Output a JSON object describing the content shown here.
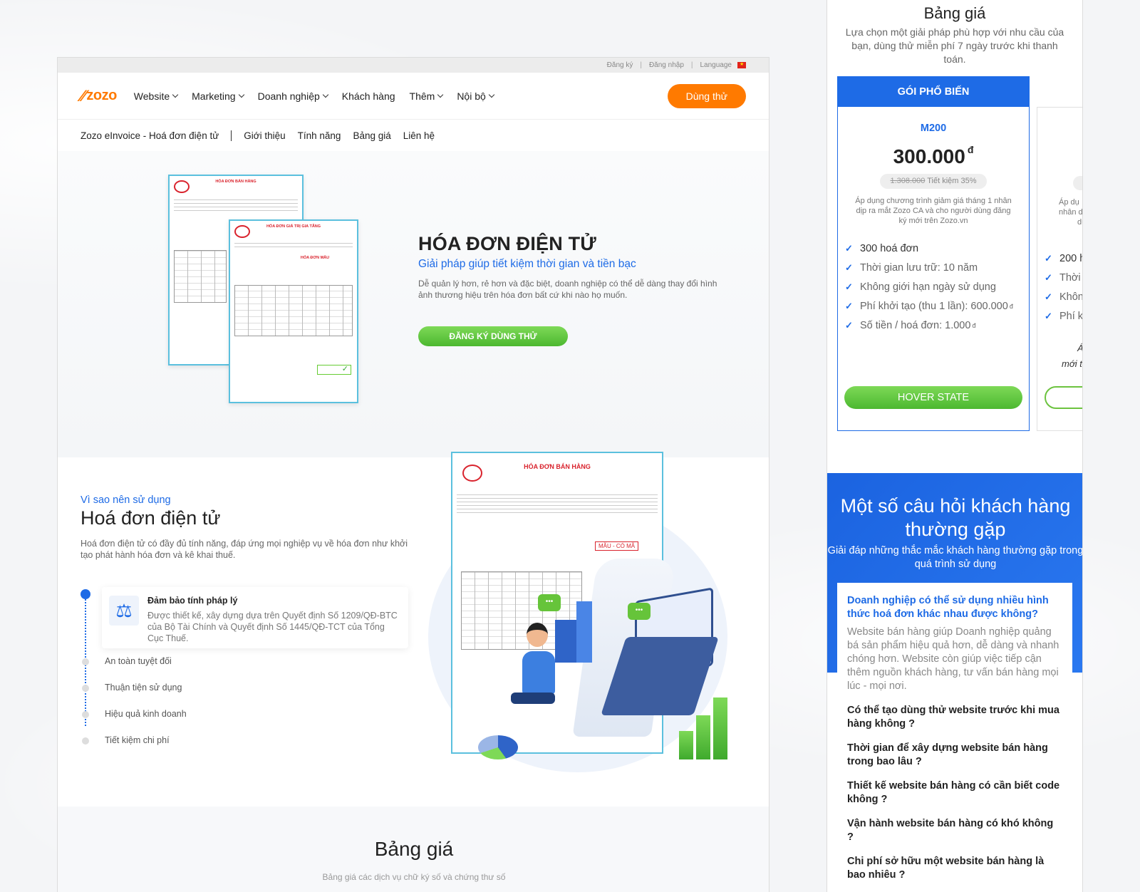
{
  "topbar": {
    "register": "Đăng ký",
    "login": "Đăng nhập",
    "language": "Language",
    "sep": "|"
  },
  "nav": {
    "logo": "zozo",
    "menu": [
      {
        "label": "Website",
        "dropdown": true
      },
      {
        "label": "Marketing",
        "dropdown": true
      },
      {
        "label": "Doanh nghiệp",
        "dropdown": true
      },
      {
        "label": "Khách hàng",
        "dropdown": false
      },
      {
        "label": "Thêm",
        "dropdown": true
      },
      {
        "label": "Nội bộ",
        "dropdown": true
      }
    ],
    "cta": "Dùng thử"
  },
  "subnav": {
    "brand": "Zozo eInvoice - Hoá đơn điện tử",
    "links": [
      "Giới thiệu",
      "Tính năng",
      "Bảng giá",
      "Liên hệ"
    ]
  },
  "invoice_small": {
    "title1": "HÓA ĐƠN BÁN HÀNG",
    "title2": "HÓA ĐƠN GIÁ TRỊ GIA TĂNG",
    "sample": "HÓA ĐƠN MẪU"
  },
  "hero": {
    "title": "HÓA ĐƠN ĐIỆN TỬ",
    "subtitle": "Giải pháp giúp tiết kiệm thời gian và tiền bạc",
    "desc": "Dễ quản lý hơn, rẻ hơn và đặc biệt, doanh nghiệp có thể dễ dàng thay đổi hình ảnh thương hiệu trên hóa đơn bất cứ khi nào họ muốn.",
    "cta": "ĐĂNG KÝ DÙNG THỬ"
  },
  "why": {
    "kicker": "Vì sao nên sử dụng",
    "title": "Hoá đơn điện tử",
    "desc": "Hoá đơn điện tử có đầy đủ tính năng, đáp ứng mọi nghiệp vụ về hóa đơn như khởi tạo phát hành hóa đơn và kê khai thuế.",
    "active": {
      "title": "Đảm bảo tính pháp lý",
      "desc": "Được thiết kế, xây dựng dựa trên Quyết định Số 1209/QĐ-BTC của Bộ Tài Chính và Quyết định Số 1445/QĐ-TCT của Tổng Cục Thuế."
    },
    "items": [
      "An toàn tuyệt đối",
      "Thuận tiện sử dụng",
      "Hiệu quả kinh doanh",
      "Tiết kiệm chi phí"
    ]
  },
  "big_invoice": {
    "title": "HÓA ĐƠN BÁN HÀNG",
    "stamp": "MẪU - CÓ MÃ"
  },
  "pricing_section": {
    "title": "Bảng giá",
    "sub": "Bảng giá các dịch vụ chữ ký số và chứng thư số"
  },
  "right": {
    "pricing_title": "Bảng giá",
    "pricing_sub": "Lựa chọn một giải pháp phù hợp với nhu cầu của bạn, dùng thử miễn phí 7 ngày trước khi thanh toán.",
    "plan": {
      "badge": "GÓI PHỔ BIẾN",
      "name": "M200",
      "price": "300.000",
      "currency": "đ",
      "old_price": "1.308.000",
      "saving": "Tiết kiệm 35%",
      "note": "Áp dụng chương trình giảm giá tháng 1 nhân dịp ra mắt Zozo CA và cho người dùng đăng ký mới trên Zozo.vn",
      "features": [
        "300 hoá đơn",
        "Thời gian lưu trữ: 10 năm",
        "Không giới hạn ngày sử dụng",
        "Phí khởi tạo (thu 1 lần): 600.000",
        "Số tiền / hoá đơn: 1.000"
      ],
      "button": "HOVER STATE"
    },
    "plan2": {
      "note_frags": [
        "Áp dụ",
        "nhân d",
        "dù"
      ],
      "features": [
        "200 h",
        "Thời",
        "Khôn",
        "Phí k"
      ],
      "em_frags": [
        "Áp",
        "mới t"
      ]
    },
    "faq": {
      "title": "Một số câu hỏi khách hàng thường gặp",
      "sub": "Giải đáp những thắc mắc khách hàng thường gặp trong quá trình sử dụng",
      "q1": "Doanh nghiệp có thể sử dụng nhiều hình thức hoá đơn khác nhau được không?",
      "a1": "Website bán hàng giúp Doanh nghiệp quảng bá sản phẩm hiệu quả hơn, dễ dàng và nhanh chóng hơn. Website còn giúp việc tiếp cận thêm nguồn khách hàng, tư vấn bán hàng mọi lúc - mọi nơi.",
      "questions": [
        "Có thể tạo dùng thử website trước khi mua hàng không ?",
        "Thời gian để xây dựng website bán hàng trong bao lâu ?",
        "Thiết kế website bán hàng có cần biết code không ?",
        "Vận hành website bán hàng có khó không ?",
        "Chi phí sở hữu một website bán hàng là bao nhiêu ?"
      ]
    }
  }
}
